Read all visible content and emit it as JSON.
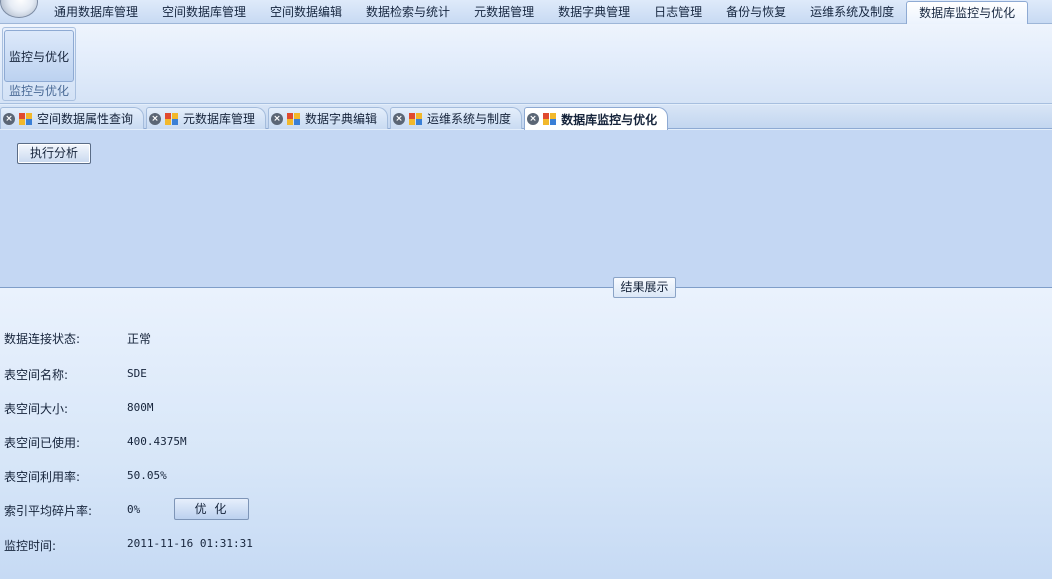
{
  "menu": {
    "tabs": [
      "通用数据库管理",
      "空间数据库管理",
      "空间数据编辑",
      "数据检索与统计",
      "元数据管理",
      "数据字典管理",
      "日志管理",
      "备份与恢复",
      "运维系统及制度",
      "数据库监控与优化"
    ],
    "active_index": 9
  },
  "ribbon": {
    "button_label": "监控与优化",
    "group_label": "监控与优化"
  },
  "doc_tabs": {
    "tabs": [
      "空间数据属性查询",
      "元数据库管理",
      "数据字典编辑",
      "运维系统与制度",
      "数据库监控与优化"
    ],
    "active_index": 4
  },
  "toolbar": {
    "analyze_label": "执行分析"
  },
  "result": {
    "title": "结果展示",
    "connection_label": "数据连接状态:",
    "connection_value": "正常",
    "tablespace_name_label": "表空间名称:",
    "tablespace_name_value": "SDE",
    "tablespace_size_label": "表空间大小:",
    "tablespace_size_value": "800M",
    "tablespace_used_label": "表空间已使用:",
    "tablespace_used_value": "400.4375M",
    "tablespace_usage_label": "表空间利用率:",
    "tablespace_usage_value": "50.05%",
    "index_frag_label": "索引平均碎片率:",
    "index_frag_value": "0%",
    "optimize_label": "优 化",
    "monitor_time_label": "监控时间:",
    "monitor_time_value": "2011-11-16 01:31:31"
  },
  "icons": {
    "doc_tab_close": "close-icon",
    "doc_tab_icon": "document-icon"
  }
}
